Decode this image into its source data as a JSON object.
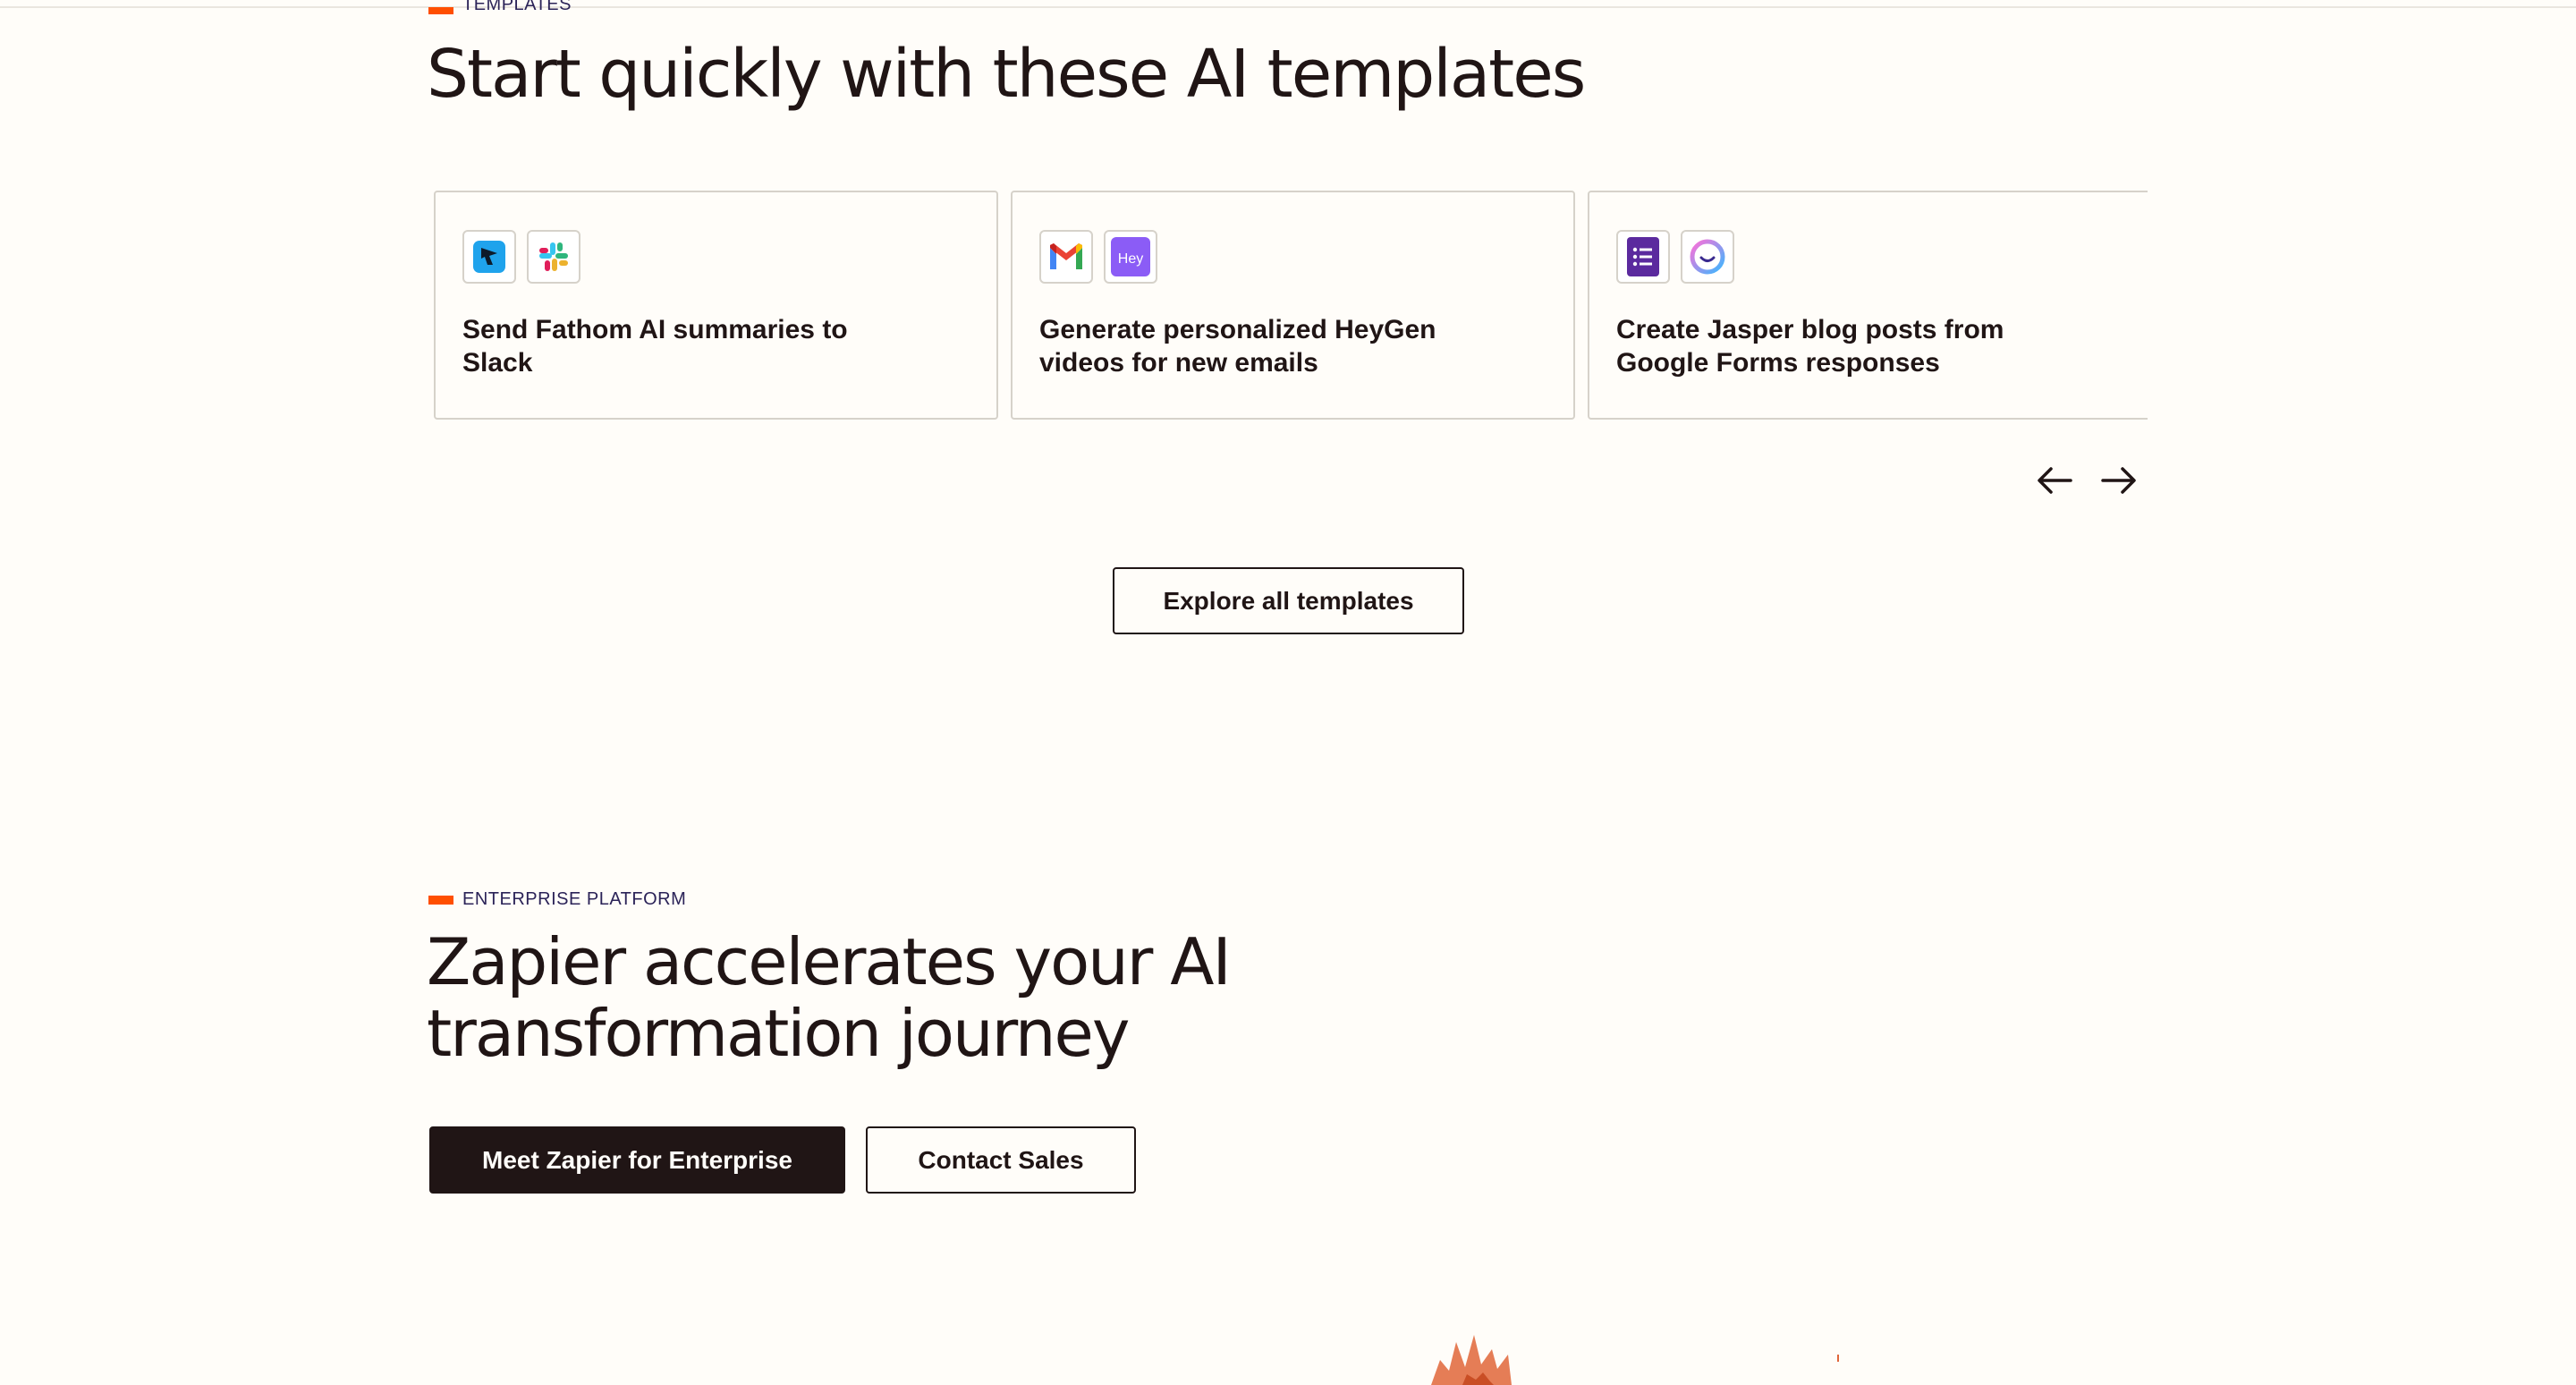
{
  "templates_section": {
    "eyebrow": "TEMPLATES",
    "headline": "Start quickly with these AI templates",
    "cards": [
      {
        "title": "Send Fathom AI summaries to Slack",
        "apps": [
          "fathom-icon",
          "slack-icon"
        ]
      },
      {
        "title": "Generate personalized HeyGen videos for new emails",
        "apps": [
          "gmail-icon",
          "heygen-icon"
        ]
      },
      {
        "title": "Create Jasper blog posts from Google Forms responses",
        "apps": [
          "google-forms-icon",
          "jasper-icon"
        ]
      }
    ],
    "explore_button": "Explore all templates"
  },
  "enterprise_section": {
    "eyebrow": "ENTERPRISE PLATFORM",
    "headline": "Zapier accelerates your AI transformation journey",
    "primary_button": "Meet Zapier for Enterprise",
    "secondary_button": "Contact Sales"
  },
  "colors": {
    "accent": "#ff4f00",
    "text": "#201515",
    "background": "#fffdf9",
    "border": "#d6d2ca"
  }
}
